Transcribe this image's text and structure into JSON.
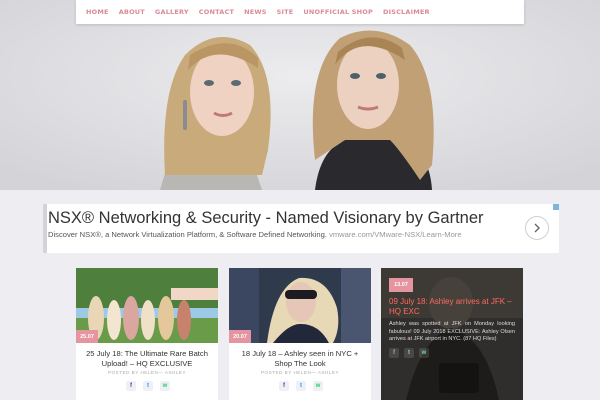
{
  "nav": {
    "items": [
      "HOME",
      "ABOUT",
      "GALLERY",
      "CONTACT",
      "NEWS",
      "SITE",
      "UNOFFICIAL SHOP",
      "DISCLAIMER"
    ]
  },
  "ad": {
    "title": "NSX® Networking & Security - Named Visionary by Gartner",
    "description": "Discover NSX®, a Network Virtualization Platform, & Software Defined Networking.",
    "url": "vmware.com/VMware-NSX/Learn-More"
  },
  "posts": [
    {
      "date": "25.07",
      "title": "25 July 18: The Ultimate Rare Batch Upload! – HQ EXCLUSIVE",
      "meta": "POSTED BY HELEN— ASHLEY"
    },
    {
      "date": "20.07",
      "title": "18 July 18 – Ashley seen in NYC + Shop The Look",
      "meta": "POSTED BY HELEN— ASHLEY"
    },
    {
      "date": "13.07",
      "title": "09 July 18: Ashley arrives at JFK – HQ EXC",
      "body": "Ashley was spotted at JFK on Monday looking fabulous! 09 July 2018 EXCLUSIVE: Ashley Olsen arrives at JFK airport in NYC. (87 HQ Files)"
    }
  ],
  "colors": {
    "nav_text": "#d98b96",
    "date_tag": "#e5959f",
    "featured_title": "#ff6a5a"
  },
  "icons": [
    "facebook-icon",
    "twitter-icon",
    "whatsapp-icon",
    "chevron-right-icon"
  ]
}
